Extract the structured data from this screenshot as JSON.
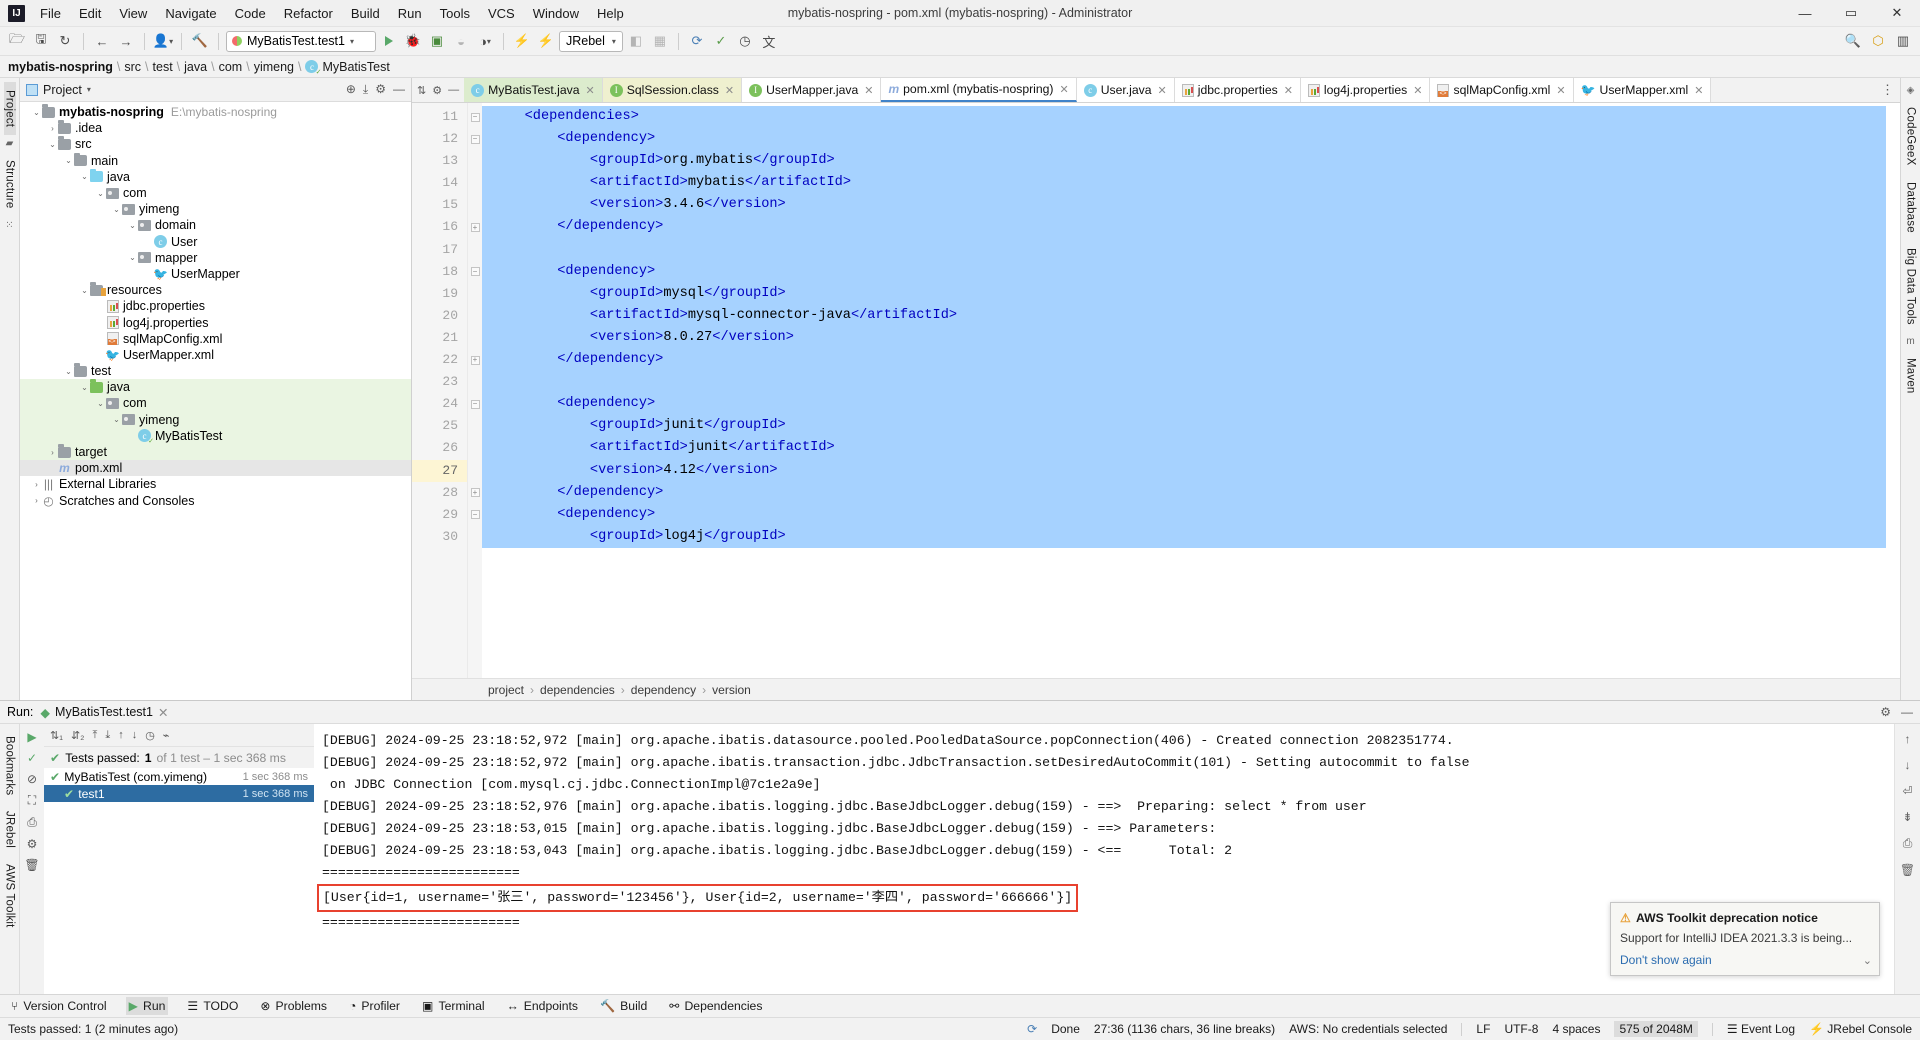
{
  "titlebar": {
    "logo": "IJ",
    "menus": [
      "File",
      "Edit",
      "View",
      "Navigate",
      "Code",
      "Refactor",
      "Build",
      "Run",
      "Tools",
      "VCS",
      "Window",
      "Help"
    ],
    "window_title": "mybatis-nospring - pom.xml (mybatis-nospring) - Administrator",
    "minimize": "—",
    "maximize": "▭",
    "close": "✕"
  },
  "toolbar": {
    "run_config": "MyBatisTest.test1",
    "jrebel": "JRebel"
  },
  "breadcrumb": {
    "project": "mybatis-nospring",
    "items": [
      "src",
      "test",
      "java",
      "com",
      "yimeng",
      "MyBatisTest"
    ]
  },
  "left_rail": {
    "project": "Project",
    "structure": "Structure"
  },
  "right_rail": {
    "items": [
      "CodeGeeX",
      "Database",
      "Big Data Tools",
      "Maven"
    ]
  },
  "bottom_rail": {
    "items": [
      "Bookmarks",
      "JRebel",
      "AWS Toolkit"
    ]
  },
  "project_panel": {
    "title": "Project",
    "tree": [
      {
        "depth": 0,
        "arrow": "v",
        "icon": "folder-module",
        "label": "mybatis-nospring",
        "bold": true,
        "path": "E:\\mybatis-nospring"
      },
      {
        "depth": 1,
        "arrow": ">",
        "icon": "folder",
        "label": ".idea"
      },
      {
        "depth": 1,
        "arrow": "v",
        "icon": "folder",
        "label": "src"
      },
      {
        "depth": 2,
        "arrow": "v",
        "icon": "folder",
        "label": "main"
      },
      {
        "depth": 3,
        "arrow": "v",
        "icon": "folder-source",
        "label": "java"
      },
      {
        "depth": 4,
        "arrow": "v",
        "icon": "package",
        "label": "com"
      },
      {
        "depth": 5,
        "arrow": "v",
        "icon": "package",
        "label": "yimeng"
      },
      {
        "depth": 6,
        "arrow": "v",
        "icon": "package",
        "label": "domain"
      },
      {
        "depth": 7,
        "arrow": "",
        "icon": "class",
        "label": "User"
      },
      {
        "depth": 6,
        "arrow": "v",
        "icon": "package",
        "label": "mapper"
      },
      {
        "depth": 7,
        "arrow": "",
        "icon": "mybatis",
        "label": "UserMapper"
      },
      {
        "depth": 3,
        "arrow": "v",
        "icon": "folder-resource",
        "label": "resources"
      },
      {
        "depth": 4,
        "arrow": "",
        "icon": "properties",
        "label": "jdbc.properties"
      },
      {
        "depth": 4,
        "arrow": "",
        "icon": "properties",
        "label": "log4j.properties"
      },
      {
        "depth": 4,
        "arrow": "",
        "icon": "xml",
        "label": "sqlMapConfig.xml"
      },
      {
        "depth": 4,
        "arrow": "",
        "icon": "mybatis",
        "label": "UserMapper.xml"
      },
      {
        "depth": 2,
        "arrow": "v",
        "icon": "folder",
        "label": "test"
      },
      {
        "depth": 3,
        "arrow": "v",
        "icon": "folder-test",
        "label": "java",
        "green": true
      },
      {
        "depth": 4,
        "arrow": "v",
        "icon": "package",
        "label": "com",
        "green": true
      },
      {
        "depth": 5,
        "arrow": "v",
        "icon": "package",
        "label": "yimeng",
        "green": true
      },
      {
        "depth": 6,
        "arrow": "",
        "icon": "class-test",
        "label": "MyBatisTest",
        "green": true
      },
      {
        "depth": 1,
        "arrow": ">",
        "icon": "folder-target",
        "label": "target",
        "green": true
      },
      {
        "depth": 1,
        "arrow": "",
        "icon": "maven",
        "label": "pom.xml",
        "selected": true
      },
      {
        "depth": 0,
        "arrow": ">",
        "icon": "library",
        "label": "External Libraries"
      },
      {
        "depth": 0,
        "arrow": ">",
        "icon": "scratch",
        "label": "Scratches and Consoles"
      }
    ]
  },
  "editor": {
    "tabs": [
      {
        "label": "MyBatisTest.java",
        "icon": "class-icon",
        "color": "green",
        "active": false
      },
      {
        "label": "SqlSession.class",
        "icon": "interface-icon",
        "color": "yellow",
        "active": false
      },
      {
        "label": "UserMapper.java",
        "icon": "interface-icon",
        "color": "white",
        "active": false
      },
      {
        "label": "pom.xml (mybatis-nospring)",
        "icon": "maven-icon",
        "color": "white",
        "active": true
      },
      {
        "label": "User.java",
        "icon": "class-icon",
        "color": "white",
        "active": false
      },
      {
        "label": "jdbc.properties",
        "icon": "properties-icon",
        "color": "white",
        "active": false
      },
      {
        "label": "log4j.properties",
        "icon": "properties-icon",
        "color": "white",
        "active": false
      },
      {
        "label": "sqlMapConfig.xml",
        "icon": "xml-icon",
        "color": "white",
        "active": false
      },
      {
        "label": "UserMapper.xml",
        "icon": "mybatis-icon",
        "color": "white",
        "active": false
      }
    ],
    "first_line": 11,
    "current_line": 27,
    "lines": [
      {
        "n": 11,
        "indent": 2,
        "text": "<dependencies>",
        "hl": true,
        "fold": "minus"
      },
      {
        "n": 12,
        "indent": 4,
        "text": "<dependency>",
        "hl": true,
        "fold": "minus"
      },
      {
        "n": 13,
        "indent": 6,
        "text": "<groupId>org.mybatis</groupId>",
        "hl": true
      },
      {
        "n": 14,
        "indent": 6,
        "text": "<artifactId>mybatis</artifactId>",
        "hl": true
      },
      {
        "n": 15,
        "indent": 6,
        "text": "<version>3.4.6</version>",
        "hl": true
      },
      {
        "n": 16,
        "indent": 4,
        "text": "</dependency>",
        "hl": true,
        "fold": "plus"
      },
      {
        "n": 17,
        "indent": 0,
        "text": "",
        "hl": true
      },
      {
        "n": 18,
        "indent": 4,
        "text": "<dependency>",
        "hl": true,
        "fold": "minus"
      },
      {
        "n": 19,
        "indent": 6,
        "text": "<groupId>mysql</groupId>",
        "hl": true
      },
      {
        "n": 20,
        "indent": 6,
        "text": "<artifactId>mysql-connector-java</artifactId>",
        "hl": true
      },
      {
        "n": 21,
        "indent": 6,
        "text": "<version>8.0.27</version>",
        "hl": true
      },
      {
        "n": 22,
        "indent": 4,
        "text": "</dependency>",
        "hl": true,
        "fold": "plus"
      },
      {
        "n": 23,
        "indent": 0,
        "text": "",
        "hl": true
      },
      {
        "n": 24,
        "indent": 4,
        "text": "<dependency>",
        "hl": true,
        "fold": "minus"
      },
      {
        "n": 25,
        "indent": 6,
        "text": "<groupId>junit</groupId>",
        "hl": true
      },
      {
        "n": 26,
        "indent": 6,
        "text": "<artifactId>junit</artifactId>",
        "hl": true
      },
      {
        "n": 27,
        "indent": 6,
        "text": "<version>4.12</version>",
        "hl": true,
        "current": true
      },
      {
        "n": 28,
        "indent": 4,
        "text": "</dependency>",
        "hl": true,
        "fold": "plus"
      },
      {
        "n": 29,
        "indent": 4,
        "text": "<dependency>",
        "hl": true,
        "fold": "minus"
      },
      {
        "n": 30,
        "indent": 6,
        "text": "<groupId>log4j</groupId>",
        "hl": true
      }
    ],
    "footer_breadcrumb": [
      "project",
      "dependencies",
      "dependency",
      "version"
    ]
  },
  "run_panel": {
    "title": "Run:",
    "tab_label": "MyBatisTest.test1",
    "status_text": "Tests passed:",
    "status_count": "1",
    "status_detail": "of 1 test – 1 sec 368 ms",
    "tree": [
      {
        "label": "MyBatisTest (com.yimeng)",
        "time": "1 sec 368 ms",
        "selected": false
      },
      {
        "label": "test1",
        "time": "1 sec 368 ms",
        "selected": true,
        "indent": 1
      }
    ],
    "console_lines": [
      "[DEBUG] 2024-09-25 23:18:52,972 [main] org.apache.ibatis.datasource.pooled.PooledDataSource.popConnection(406) - Created connection 2082351774.",
      "[DEBUG] 2024-09-25 23:18:52,972 [main] org.apache.ibatis.transaction.jdbc.JdbcTransaction.setDesiredAutoCommit(101) - Setting autocommit to false",
      " on JDBC Connection [com.mysql.cj.jdbc.ConnectionImpl@7c1e2a9e]",
      "[DEBUG] 2024-09-25 23:18:52,976 [main] org.apache.ibatis.logging.jdbc.BaseJdbcLogger.debug(159) - ==>  Preparing: select * from user",
      "[DEBUG] 2024-09-25 23:18:53,015 [main] org.apache.ibatis.logging.jdbc.BaseJdbcLogger.debug(159) - ==> Parameters:",
      "[DEBUG] 2024-09-25 23:18:53,043 [main] org.apache.ibatis.logging.jdbc.BaseJdbcLogger.debug(159) - <==      Total: 2",
      "========================="
    ],
    "result_line": "[User{id=1, username='张三', password='123456'}, User{id=2, username='李四', password='666666'}]",
    "trailing_line": "========================="
  },
  "notification": {
    "title": "AWS Toolkit deprecation notice",
    "body": "Support for IntelliJ IDEA 2021.3.3 is being...",
    "link": "Don't show again",
    "expand": "⌄"
  },
  "tool_window_bar": {
    "items": [
      {
        "label": "Version Control",
        "icon": "branch-icon"
      },
      {
        "label": "Run",
        "icon": "run-icon",
        "active": true
      },
      {
        "label": "TODO",
        "icon": "todo-icon"
      },
      {
        "label": "Problems",
        "icon": "problems-icon"
      },
      {
        "label": "Profiler",
        "icon": "profiler-icon"
      },
      {
        "label": "Terminal",
        "icon": "terminal-icon"
      },
      {
        "label": "Endpoints",
        "icon": "endpoints-icon"
      },
      {
        "label": "Build",
        "icon": "build-icon"
      },
      {
        "label": "Dependencies",
        "icon": "dependencies-icon"
      }
    ]
  },
  "statusbar": {
    "left": "Tests passed: 1 (2 minutes ago)",
    "done": "Done",
    "position": "27:36 (1136 chars, 36 line breaks)",
    "aws": "AWS: No credentials selected",
    "line_sep": "LF",
    "encoding": "UTF-8",
    "indent": "4 spaces",
    "memory": "575 of 2048M",
    "event_log": "Event Log",
    "jrebel_console": "JRebel Console"
  }
}
